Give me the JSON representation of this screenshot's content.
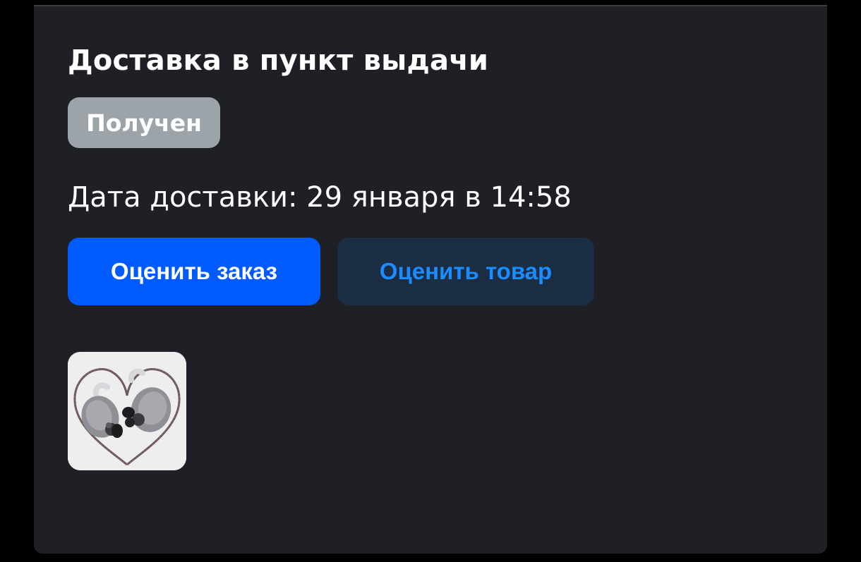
{
  "delivery": {
    "title": "Доставка в пункт выдачи",
    "status_badge": "Получен",
    "date_text": "Дата доставки: 29 января в 14:58"
  },
  "actions": {
    "rate_order_label": "Оценить заказ",
    "rate_product_label": "Оценить товар"
  },
  "product": {
    "thumbnail_icon": "in-ear-earphones-image"
  },
  "colors": {
    "card_background": "#1f2025",
    "badge_background": "#9ca3a9",
    "primary_button": "#005bff",
    "secondary_button_bg": "#1b2d42",
    "secondary_button_text": "#1a8cff"
  }
}
